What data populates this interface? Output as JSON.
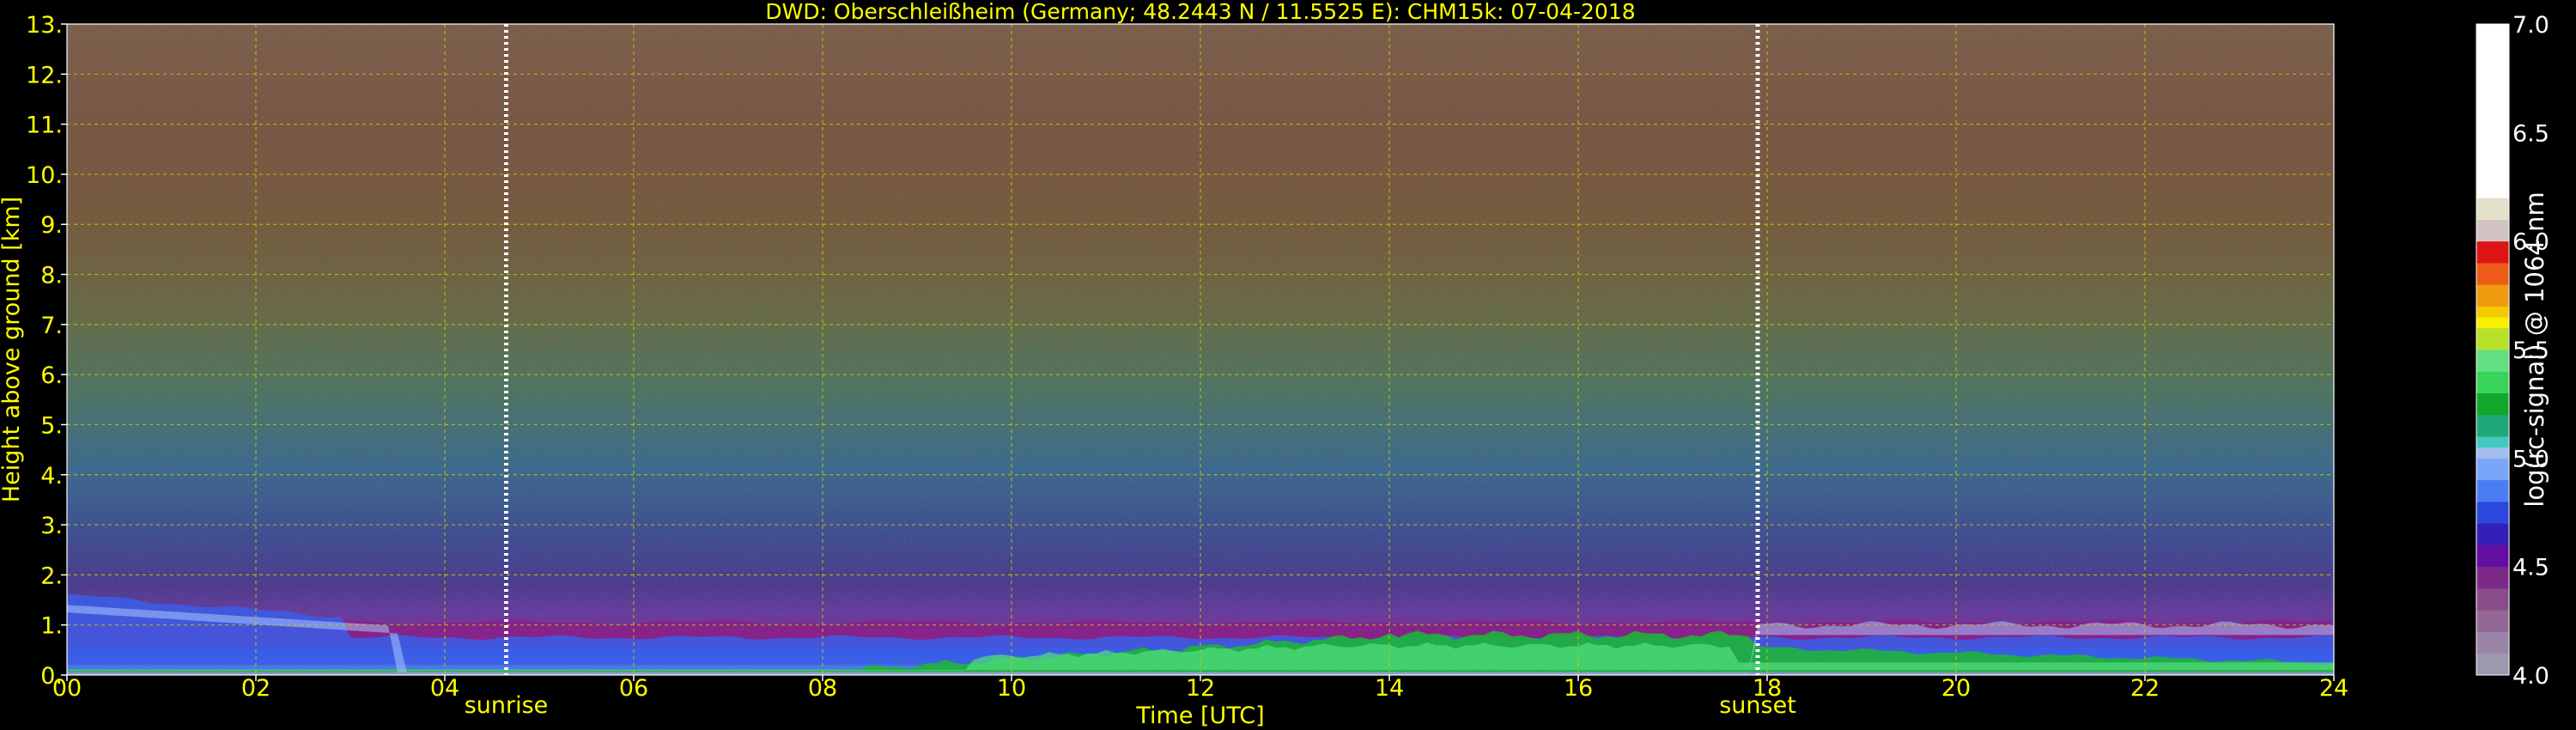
{
  "chart_data": {
    "type": "heatmap",
    "title": "DWD: Oberschleißheim (Germany; 48.2443 N / 11.5525 E):    CHM15k: 07-04-2018",
    "xlabel": "Time [UTC]",
    "ylabel": "Height above ground [km]",
    "xlim": [
      0,
      24
    ],
    "ylim": [
      0,
      13
    ],
    "x_ticks": [
      {
        "value": 0,
        "label": "00"
      },
      {
        "value": 2,
        "label": "02"
      },
      {
        "value": 4,
        "label": "04"
      },
      {
        "value": 6,
        "label": "06"
      },
      {
        "value": 8,
        "label": "08"
      },
      {
        "value": 10,
        "label": "10"
      },
      {
        "value": 12,
        "label": "12"
      },
      {
        "value": 14,
        "label": "14"
      },
      {
        "value": 16,
        "label": "16"
      },
      {
        "value": 18,
        "label": "18"
      },
      {
        "value": 20,
        "label": "20"
      },
      {
        "value": 22,
        "label": "22"
      },
      {
        "value": 24,
        "label": "24"
      }
    ],
    "y_ticks": [
      {
        "value": 0,
        "label": "0."
      },
      {
        "value": 1,
        "label": "1."
      },
      {
        "value": 2,
        "label": "2."
      },
      {
        "value": 3,
        "label": "3."
      },
      {
        "value": 4,
        "label": "4."
      },
      {
        "value": 5,
        "label": "5."
      },
      {
        "value": 6,
        "label": "6."
      },
      {
        "value": 7,
        "label": "7."
      },
      {
        "value": 8,
        "label": "8."
      },
      {
        "value": 9,
        "label": "9."
      },
      {
        "value": 10,
        "label": "10."
      },
      {
        "value": 11,
        "label": "11."
      },
      {
        "value": 12,
        "label": "12."
      },
      {
        "value": 13,
        "label": "13."
      }
    ],
    "grid": true,
    "events": [
      {
        "name": "sunrise",
        "time": 4.65
      },
      {
        "name": "sunset",
        "time": 17.9
      }
    ],
    "colorbar": {
      "label": "log(rc-signal) @ 1064 nm",
      "range": [
        4.0,
        7.0
      ],
      "ticks": [
        {
          "value": 4.0,
          "label": "4.0"
        },
        {
          "value": 4.5,
          "label": "4.5"
        },
        {
          "value": 5.0,
          "label": "5.0"
        },
        {
          "value": 5.5,
          "label": "5.5"
        },
        {
          "value": 6.0,
          "label": "6.0"
        },
        {
          "value": 6.5,
          "label": "6.5"
        },
        {
          "value": 7.0,
          "label": "7.0"
        }
      ],
      "segments": [
        {
          "from": 4.0,
          "to": 4.1,
          "color": "#9d9aaf"
        },
        {
          "from": 4.1,
          "to": 4.2,
          "color": "#9a85a8"
        },
        {
          "from": 4.2,
          "to": 4.3,
          "color": "#946795"
        },
        {
          "from": 4.3,
          "to": 4.4,
          "color": "#8a4b8b"
        },
        {
          "from": 4.4,
          "to": 4.5,
          "color": "#7c2a88"
        },
        {
          "from": 4.5,
          "to": 4.6,
          "color": "#620ea2"
        },
        {
          "from": 4.6,
          "to": 4.7,
          "color": "#3320b8"
        },
        {
          "from": 4.7,
          "to": 4.8,
          "color": "#2a48de"
        },
        {
          "from": 4.8,
          "to": 4.9,
          "color": "#4b7cf4"
        },
        {
          "from": 4.9,
          "to": 5.0,
          "color": "#79a6f9"
        },
        {
          "from": 5.0,
          "to": 5.05,
          "color": "#a4beef"
        },
        {
          "from": 5.05,
          "to": 5.1,
          "color": "#42c8c0"
        },
        {
          "from": 5.1,
          "to": 5.2,
          "color": "#1fa978"
        },
        {
          "from": 5.2,
          "to": 5.3,
          "color": "#12a62a"
        },
        {
          "from": 5.3,
          "to": 5.4,
          "color": "#38d45a"
        },
        {
          "from": 5.4,
          "to": 5.5,
          "color": "#63e082"
        },
        {
          "from": 5.5,
          "to": 5.6,
          "color": "#b8e12a"
        },
        {
          "from": 5.6,
          "to": 5.65,
          "color": "#f7f000"
        },
        {
          "from": 5.65,
          "to": 5.7,
          "color": "#f5c800"
        },
        {
          "from": 5.7,
          "to": 5.8,
          "color": "#ef9b10"
        },
        {
          "from": 5.8,
          "to": 5.9,
          "color": "#ee5a18"
        },
        {
          "from": 5.9,
          "to": 6.0,
          "color": "#dd1414"
        },
        {
          "from": 6.0,
          "to": 6.1,
          "color": "#d3c4c4"
        },
        {
          "from": 6.1,
          "to": 6.2,
          "color": "#e3e0cc"
        },
        {
          "from": 6.2,
          "to": 7.0,
          "color": "#ffffff"
        }
      ]
    }
  }
}
